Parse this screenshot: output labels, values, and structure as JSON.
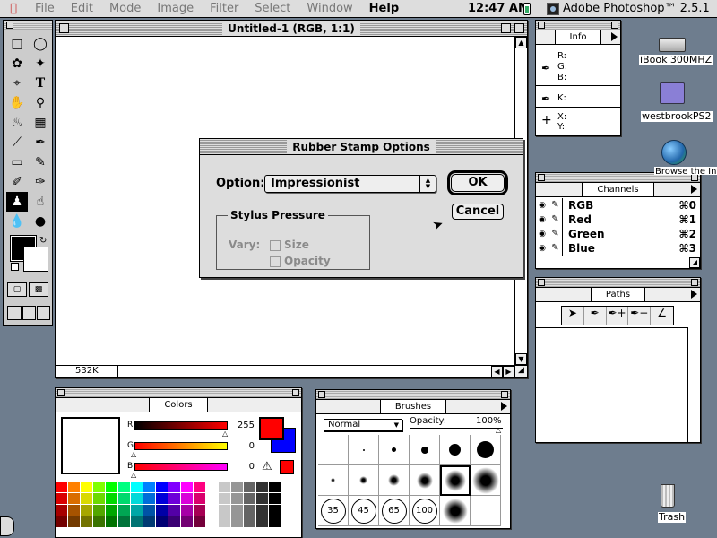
{
  "menubar": {
    "items": [
      "File",
      "Edit",
      "Mode",
      "Image",
      "Filter",
      "Select",
      "Window",
      "Help"
    ],
    "clock": "12:47 AM",
    "app_name": "Adobe Photoshop™ 2.5.1"
  },
  "document": {
    "title": "Untitled-1 (RGB, 1:1)",
    "size_readout": "532K"
  },
  "dialog": {
    "title": "Rubber Stamp Options",
    "option_label": "Option:",
    "option_value": "Impressionist",
    "ok_label": "OK",
    "cancel_label": "Cancel",
    "group_title": "Stylus Pressure",
    "vary_label": "Vary:",
    "size_label": "Size",
    "opacity_label": "Opacity"
  },
  "info": {
    "tab": "Info",
    "rgb_labels": [
      "R:",
      "G:",
      "B:"
    ],
    "k_label": "K:",
    "xy_labels": [
      "X:",
      "Y:"
    ]
  },
  "channels": {
    "tab": "Channels",
    "rows": [
      {
        "name": "RGB",
        "shortcut": "⌘0"
      },
      {
        "name": "Red",
        "shortcut": "⌘1"
      },
      {
        "name": "Green",
        "shortcut": "⌘2"
      },
      {
        "name": "Blue",
        "shortcut": "⌘3"
      }
    ]
  },
  "paths": {
    "tab": "Paths"
  },
  "colors": {
    "tab": "Colors",
    "r_label": "R",
    "g_label": "G",
    "b_label": "B",
    "r_value": "255",
    "g_value": "0",
    "b_value": "0",
    "foreground_color": "#ff0000",
    "background_color": "#0000ff",
    "swatch_colors": [
      "#ff0000",
      "#ffff00",
      "#00ff00",
      "#00ffff",
      "#0000ff",
      "#ff00ff",
      "#ffffff",
      "#eeeeee",
      "#dddddd",
      "#cccccc",
      "#bbbbbb",
      "#999999",
      "#888888",
      "#777777",
      "#555555",
      "#444444",
      "#222222",
      "#000000"
    ]
  },
  "brushes": {
    "tab": "Brushes",
    "mode": "Normal",
    "opacity_label": "Opacity:",
    "opacity_value": "100%",
    "sizes": [
      "35",
      "45",
      "65",
      "100"
    ]
  },
  "desktop": {
    "icons": [
      "iBook 300MHZ",
      "westbrookPS2",
      "Browse the Internet",
      "Trash"
    ]
  }
}
